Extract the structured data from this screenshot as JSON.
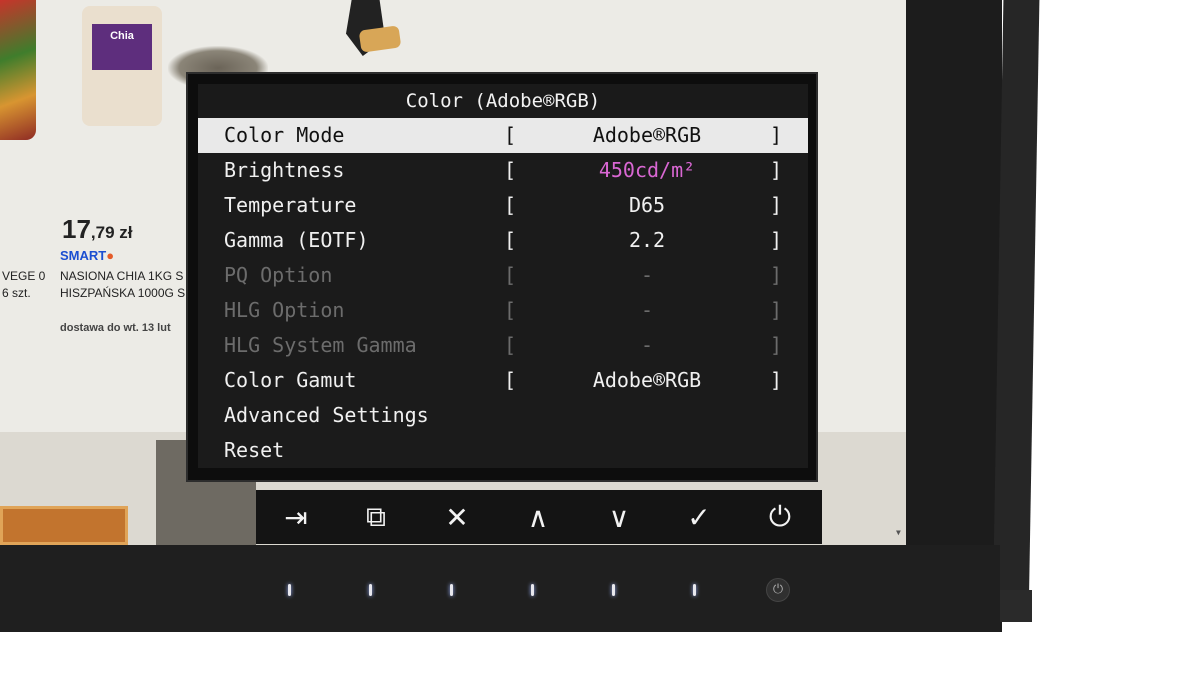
{
  "background_page": {
    "chia_label": "Chia",
    "price_main": "17",
    "price_fraction": ",79 zł",
    "brand": "SMART",
    "product_lines": "NASIONA CHIA 1KG S\nHISZPAŃSKA 1000G S",
    "left_lines": "VEGE 0\n6 szt.",
    "delivery": "dostawa do wt. 13 lut"
  },
  "osd": {
    "title": "Color (Adobe®RGB)",
    "rows": [
      {
        "label": "Color Mode",
        "value": "Adobe®RGB",
        "bracket_open": "[",
        "bracket_close": "]",
        "state": "selected"
      },
      {
        "label": "Brightness",
        "value": "450cd/m²",
        "bracket_open": "[",
        "bracket_close": "]",
        "state": "normal",
        "value_color": "#d967d3"
      },
      {
        "label": "Temperature",
        "value": "D65",
        "bracket_open": "[",
        "bracket_close": "]",
        "state": "normal"
      },
      {
        "label": "Gamma (EOTF)",
        "value": "2.2",
        "bracket_open": "[",
        "bracket_close": "]",
        "state": "normal"
      },
      {
        "label": "PQ Option",
        "value": "-",
        "bracket_open": "[",
        "bracket_close": "]",
        "state": "disabled"
      },
      {
        "label": "HLG Option",
        "value": "-",
        "bracket_open": "[",
        "bracket_close": "]",
        "state": "disabled"
      },
      {
        "label": "HLG System Gamma",
        "value": "-",
        "bracket_open": "[",
        "bracket_close": "]",
        "state": "disabled"
      },
      {
        "label": "Color Gamut",
        "value": "Adobe®RGB",
        "bracket_open": "[",
        "bracket_close": "]",
        "state": "normal"
      },
      {
        "label": "Advanced Settings",
        "state": "normal"
      },
      {
        "label": "Reset",
        "state": "normal"
      }
    ]
  },
  "buttons": [
    {
      "name": "input-select-icon",
      "glyph": "⇥"
    },
    {
      "name": "window-icon",
      "glyph": "⧉"
    },
    {
      "name": "close-icon",
      "glyph": "✕"
    },
    {
      "name": "up-icon",
      "glyph": "∧"
    },
    {
      "name": "down-icon",
      "glyph": "∨"
    },
    {
      "name": "check-icon",
      "glyph": "✓"
    },
    {
      "name": "power-icon",
      "glyph": "⏻"
    }
  ],
  "colors": {
    "selected_row_bg": "#e9e9e9",
    "brightness_value": "#d967d3",
    "disabled_text": "#6c6c6c"
  }
}
